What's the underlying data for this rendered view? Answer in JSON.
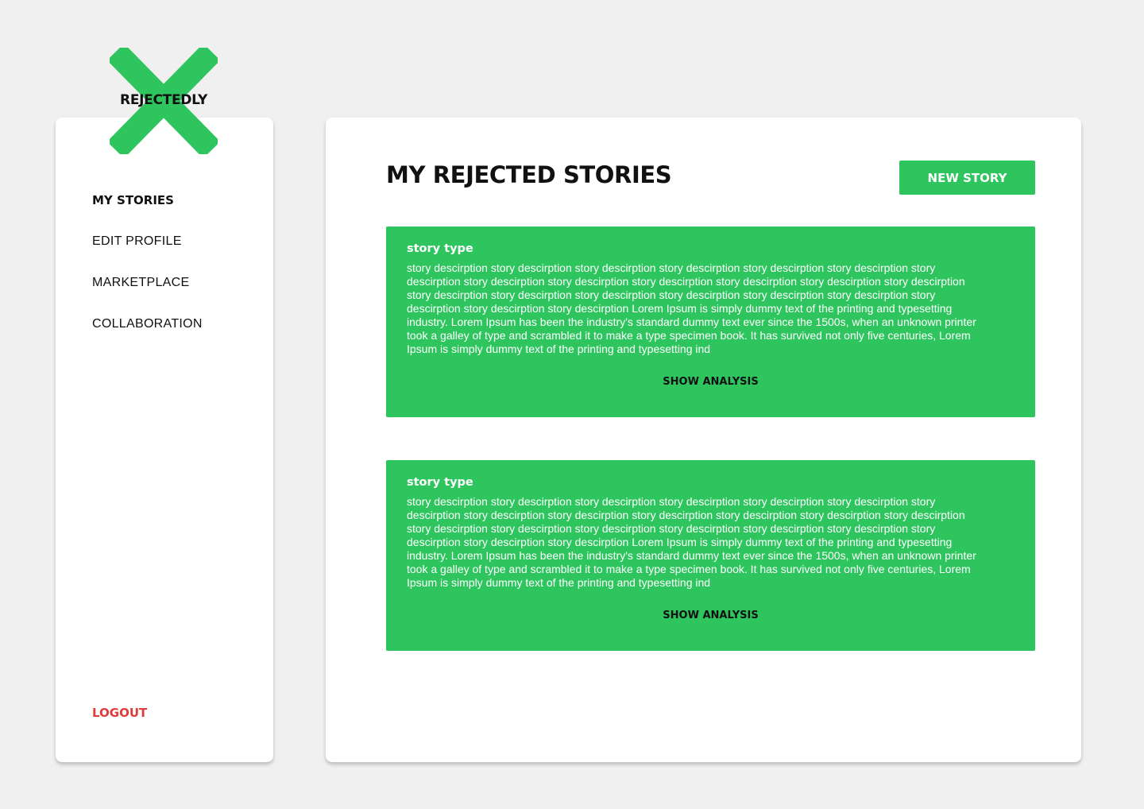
{
  "brand": {
    "name": "REJECTEDLY",
    "logo_icon": "x-cross-icon",
    "accent_color": "#2ec55e"
  },
  "sidebar": {
    "items": [
      {
        "label": "MY STORIES",
        "active": true
      },
      {
        "label": "EDIT PROFILE",
        "active": false
      },
      {
        "label": "MARKETPLACE",
        "active": false
      },
      {
        "label": "COLLABORATION",
        "active": false
      }
    ],
    "logout_label": "LOGOUT",
    "logout_color": "#e03a3a"
  },
  "main": {
    "title": "MY REJECTED STORIES",
    "new_story_label": "NEW STORY",
    "stories": [
      {
        "type": "story type",
        "description": "story descirption story descirption story descirption story descirption story descirption story descirption story descirption story descirption story descirption story descirption story descirption story descirption story descirption story descirption story descirption story descirption story descirption story descirption story descirption story descirption story descirption story descirption  Lorem Ipsum is simply dummy text of the printing and typesetting industry. Lorem Ipsum has been the industry's standard dummy text ever since the 1500s, when an unknown printer took a galley of type and scrambled it to make a type specimen book. It has survived not only five centuries, Lorem Ipsum is simply dummy text of the printing and typesetting ind",
        "action_label": "SHOW ANALYSIS"
      },
      {
        "type": "story type",
        "description": "story descirption story descirption story descirption story descirption story descirption story descirption story descirption story descirption story descirption story descirption story descirption story descirption story descirption story descirption story descirption story descirption story descirption story descirption story descirption story descirption story descirption story descirption  Lorem Ipsum is simply dummy text of the printing and typesetting industry. Lorem Ipsum has been the industry's standard dummy text ever since the 1500s, when an unknown printer took a galley of type and scrambled it to make a type specimen book. It has survived not only five centuries, Lorem Ipsum is simply dummy text of the printing and typesetting ind",
        "action_label": "SHOW ANALYSIS"
      }
    ]
  }
}
